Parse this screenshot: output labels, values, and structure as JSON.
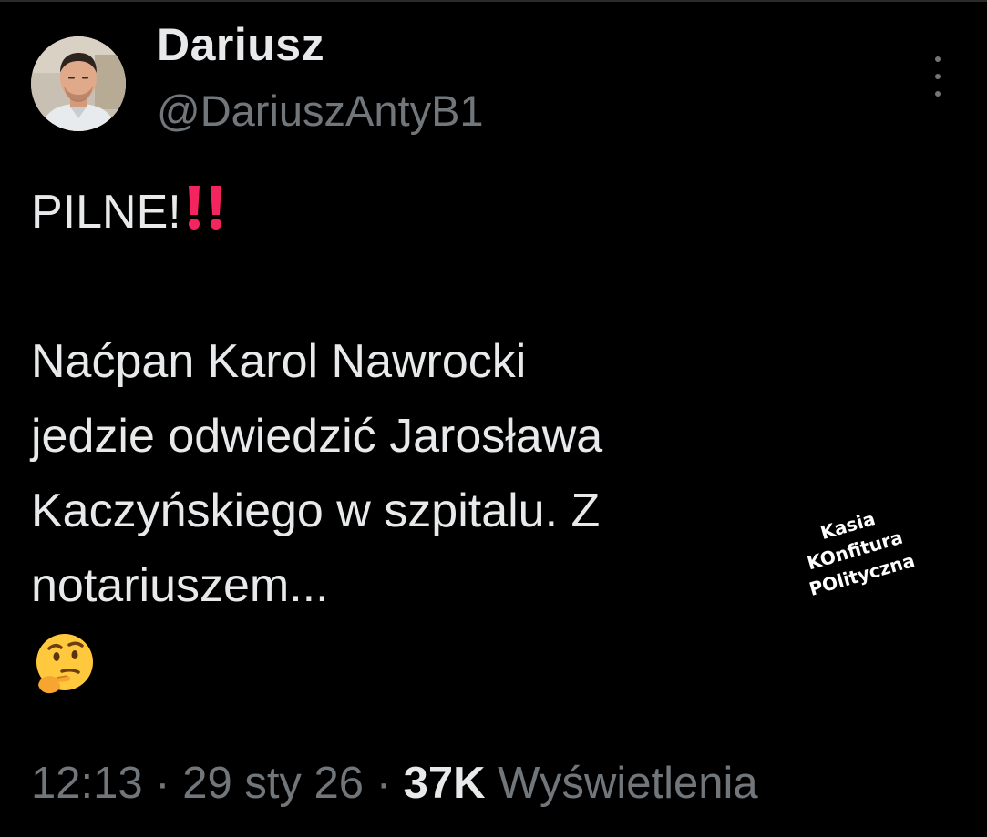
{
  "author": {
    "display_name": "Dariusz",
    "handle": "@DariuszAntyB1",
    "avatar_icon": "profile-photo"
  },
  "more_icon": "more-options-icon",
  "tweet": {
    "lines": [
      "PILNE!",
      "Naćpan Karol Nawrocki",
      "jedzie odwiedzić Jarosława",
      "Kaczyńskiego w szpitalu. Z",
      "notariuszem..."
    ],
    "emojis": [
      "double-exclamation-icon",
      "thinking-face-icon"
    ]
  },
  "watermark": {
    "lines": [
      "Kasia",
      "KOnfitura",
      "POlityczna"
    ]
  },
  "meta": {
    "time": "12:13",
    "separator": "·",
    "date": "29 sty 26",
    "views_count": "37K",
    "views_label": "Wyświetlenia"
  },
  "colors": {
    "background": "#000000",
    "text_primary": "#e7e9ea",
    "text_secondary": "#71767b",
    "emoji_red": "#f4245e",
    "emoji_yellow": "#ffc83d"
  }
}
